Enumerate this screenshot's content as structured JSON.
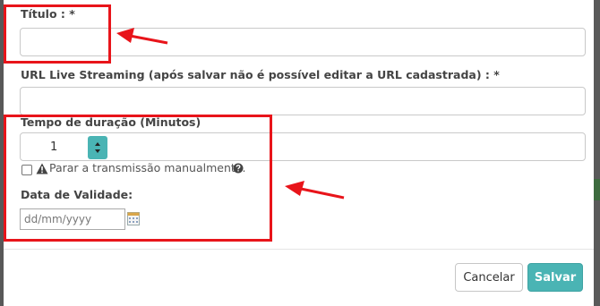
{
  "form": {
    "title_label": "Título : *",
    "title_value": "",
    "url_label": "URL Live Streaming (após salvar não é possível editar a URL cadastrada) : *",
    "url_value": "",
    "duration_label": "Tempo de duração (Minutos)",
    "duration_value": "1",
    "manual_stop_label": "Parar a transmissão manualmente.",
    "manual_stop_checked": false,
    "validity_label": "Data de Validade:",
    "validity_placeholder": "dd/mm/yyyy"
  },
  "footer": {
    "cancel_label": "Cancelar",
    "save_label": "Salvar"
  },
  "colors": {
    "accent": "#4ab4b4",
    "highlight": "#e8141a",
    "overlay": "#6b6b6b"
  },
  "icons": {
    "warning": "warning-icon",
    "help": "question-circle-icon",
    "calendar": "calendar-icon",
    "spinner": "up-down-caret-icon"
  }
}
